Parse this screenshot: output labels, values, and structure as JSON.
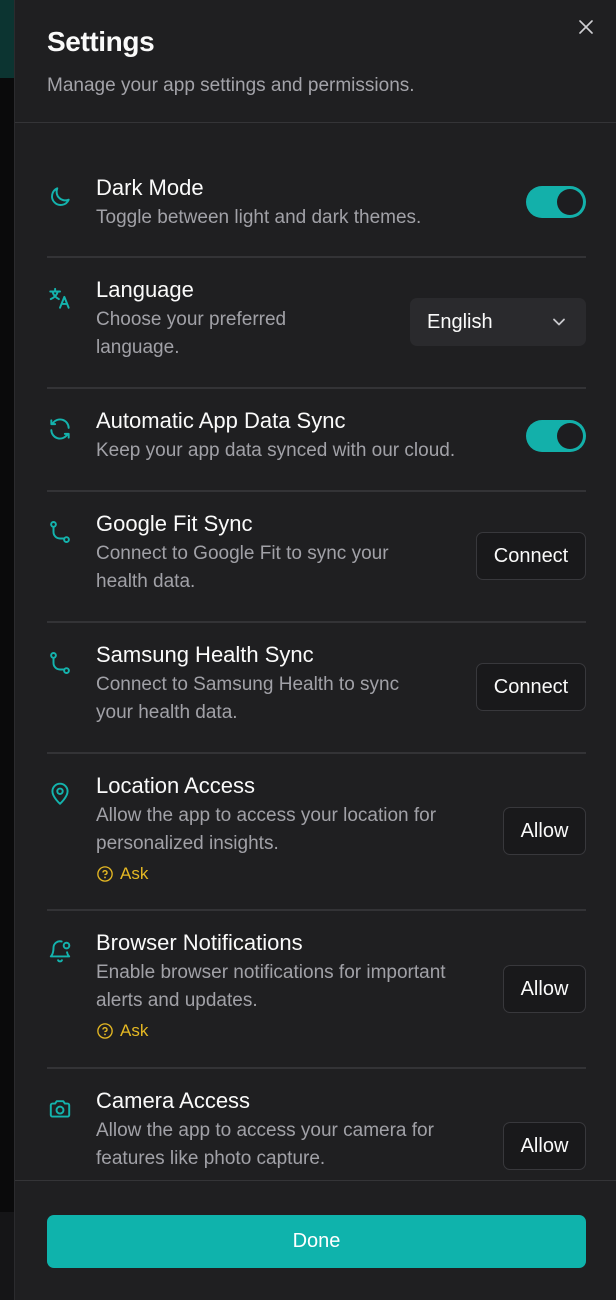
{
  "header": {
    "title": "Settings",
    "subtitle": "Manage your app settings and permissions."
  },
  "colors": {
    "accent": "#14b3ad",
    "warning": "#e5b823",
    "panel": "#1f1f21"
  },
  "settings": [
    {
      "icon": "moon-icon",
      "title": "Dark Mode",
      "description": [
        "Toggle between light and dark themes."
      ],
      "control": "toggle",
      "enabled": true
    },
    {
      "icon": "translate-icon",
      "title": "Language",
      "description": [
        "Choose your preferred",
        "language."
      ],
      "control": "select",
      "value": "English"
    },
    {
      "icon": "refresh-icon",
      "title": "Automatic App Data Sync",
      "description": [
        "Keep your app data synced with our cloud."
      ],
      "control": "toggle",
      "enabled": true
    },
    {
      "icon": "route-icon",
      "title": "Google Fit Sync",
      "description": [
        "Connect to Google Fit to sync your",
        "health data."
      ],
      "control": "button",
      "button_label": "Connect"
    },
    {
      "icon": "route-icon",
      "title": "Samsung Health Sync",
      "description": [
        "Connect to Samsung Health to sync",
        "your health data."
      ],
      "control": "button",
      "button_label": "Connect"
    },
    {
      "icon": "map-pin-icon",
      "title": "Location Access",
      "description": [
        "Allow the app to access your location for",
        "personalized insights."
      ],
      "status": "Ask",
      "control": "button",
      "button_label": "Allow"
    },
    {
      "icon": "bell-icon",
      "title": "Browser Notifications",
      "description": [
        "Enable browser notifications for important",
        "alerts and updates."
      ],
      "status": "Ask",
      "control": "button",
      "button_label": "Allow"
    },
    {
      "icon": "camera-icon",
      "title": "Camera Access",
      "description": [
        "Allow the app to access your camera for",
        "features like photo capture."
      ],
      "control": "button",
      "button_label": "Allow"
    }
  ],
  "footer": {
    "done_label": "Done"
  }
}
